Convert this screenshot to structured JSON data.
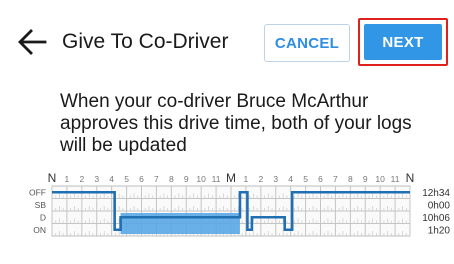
{
  "header": {
    "back_icon": "arrow-left-icon",
    "title": "Give To Co-Driver",
    "cancel_label": "CANCEL",
    "next_label": "NEXT"
  },
  "message": {
    "line1": "When your co-driver Bruce McArthur",
    "line2": "approves this drive time, both of your logs",
    "line3": "will be updated"
  },
  "graph": {
    "hour_labels": [
      "N",
      "1",
      "2",
      "3",
      "4",
      "5",
      "6",
      "7",
      "8",
      "9",
      "10",
      "11",
      "M",
      "1",
      "2",
      "3",
      "4",
      "5",
      "6",
      "7",
      "8",
      "9",
      "10",
      "11",
      "N"
    ],
    "status_rows": [
      "OFF",
      "SB",
      "D",
      "ON"
    ],
    "totals": [
      "12h34",
      "0h00",
      "10h06",
      "1h20"
    ],
    "line_color": "#1f6fb2",
    "highlight_color": "#5aa7e6",
    "highlight_range": [
      4.6,
      12.6
    ],
    "log_segments": [
      {
        "status": "OFF",
        "from": 0,
        "to": 4.2
      },
      {
        "status": "ON",
        "from": 4.2,
        "to": 4.6
      },
      {
        "status": "D",
        "from": 4.6,
        "to": 12.6
      },
      {
        "status": "OFF",
        "from": 12.6,
        "to": 13.1
      },
      {
        "status": "ON",
        "from": 13.1,
        "to": 13.4
      },
      {
        "status": "D",
        "from": 13.4,
        "to": 15.6
      },
      {
        "status": "ON",
        "from": 15.6,
        "to": 16.1
      },
      {
        "status": "OFF",
        "from": 16.1,
        "to": 24
      }
    ]
  }
}
